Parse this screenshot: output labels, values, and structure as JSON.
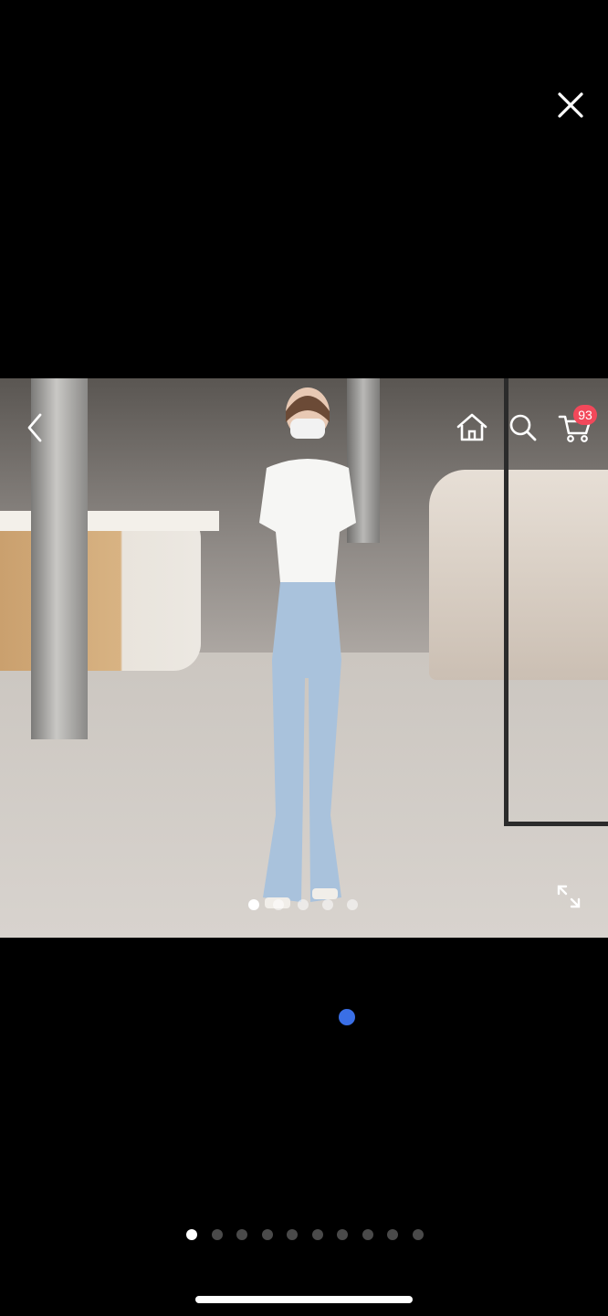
{
  "cart": {
    "badge_count": "93"
  },
  "photo": {
    "dots_total": 5,
    "active_dot": 0
  },
  "gallery": {
    "dots_total": 10,
    "active_dot": 0
  },
  "icons": {
    "close": "close-icon",
    "back": "chevron-left-icon",
    "home": "home-icon",
    "search": "search-icon",
    "cart": "cart-icon",
    "expand": "expand-icon"
  },
  "colors": {
    "badge": "#f2485a",
    "loading_dot": "#3a6fe6",
    "background": "#000000"
  }
}
